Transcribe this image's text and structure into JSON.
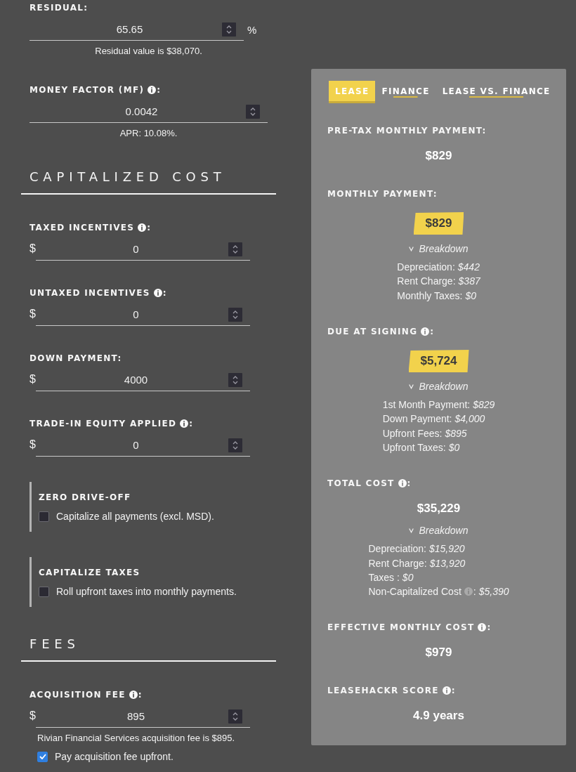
{
  "form": {
    "sections": [
      {
        "items": [
          {
            "kind": "number",
            "label": "RESIDUAL:",
            "value": "65.65",
            "unit": "%",
            "note": "Residual value is $38,070."
          },
          {
            "kind": "number",
            "label": "MONEY FACTOR (MF)",
            "info": true,
            "label_tail": ":",
            "value": "0.0042",
            "note": "APR: 10.08%."
          }
        ]
      },
      {
        "heading": "CAPITALIZED COST",
        "items": [
          {
            "kind": "number",
            "label": "TAXED INCENTIVES",
            "info": true,
            "label_tail": ":",
            "prefix": "$",
            "value": "0"
          },
          {
            "kind": "number",
            "label": "UNTAXED INCENTIVES",
            "info": true,
            "label_tail": ":",
            "prefix": "$",
            "value": "0"
          },
          {
            "kind": "number",
            "label": "DOWN PAYMENT:",
            "prefix": "$",
            "value": "4000"
          },
          {
            "kind": "number",
            "label": "TRADE-IN EQUITY APPLIED",
            "info": true,
            "label_tail": ":",
            "prefix": "$",
            "value": "0"
          },
          {
            "kind": "option",
            "title": "ZERO DRIVE-OFF",
            "checkbox": {
              "label": "Capitalize all payments (excl. MSD).",
              "checked": false
            }
          },
          {
            "kind": "option",
            "title": "CAPITALIZE TAXES",
            "checkbox": {
              "label": "Roll upfront taxes into monthly payments.",
              "checked": false
            }
          }
        ]
      },
      {
        "heading": "FEES",
        "items": [
          {
            "kind": "number",
            "label": "ACQUISITION FEE",
            "info": true,
            "label_tail": ":",
            "prefix": "$",
            "value": "895",
            "note": "Rivian Financial Services acquisition fee is $895.",
            "checkbox": {
              "label": "Pay acquisition fee upfront.",
              "checked": true
            }
          }
        ]
      }
    ]
  },
  "results": {
    "tabs": [
      {
        "label": "LEASE",
        "selected": true
      },
      {
        "label": "FINANCE",
        "selected": false
      },
      {
        "label": "LEASE VS. FINANCE",
        "selected": false
      }
    ],
    "metrics": [
      {
        "label": "PRE-TAX MONTHLY PAYMENT:",
        "value": "$829",
        "highlighted": false
      },
      {
        "label": "MONTHLY PAYMENT:",
        "value": "$829",
        "highlighted": true,
        "breakdown": {
          "toggle": "Breakdown",
          "expanded": true,
          "lines": [
            {
              "label": "Depreciation:",
              "value": "$442"
            },
            {
              "label": "Rent Charge:",
              "value": "$387"
            },
            {
              "label": "Monthly Taxes:",
              "value": "$0"
            }
          ]
        }
      },
      {
        "label": "DUE AT SIGNING",
        "info": true,
        "label_tail": ":",
        "value": "$5,724",
        "highlighted": true,
        "breakdown": {
          "toggle": "Breakdown",
          "expanded": true,
          "lines": [
            {
              "label": "1st Month Payment:",
              "value": "$829"
            },
            {
              "label": "Down Payment:",
              "value": "$4,000"
            },
            {
              "label": "Upfront Fees:",
              "value": "$895"
            },
            {
              "label": "Upfront Taxes:",
              "value": "$0"
            }
          ]
        }
      },
      {
        "label": "TOTAL COST",
        "info": true,
        "label_tail": ":",
        "value": "$35,229",
        "highlighted": false,
        "breakdown": {
          "toggle": "Breakdown",
          "expanded": true,
          "lines": [
            {
              "label": "Depreciation:",
              "value": "$15,920"
            },
            {
              "label": "Rent Charge:",
              "value": "$13,920"
            },
            {
              "label": "Taxes :",
              "value": "$0"
            },
            {
              "label": "Non-Capitalized Cost",
              "info": true,
              "label_tail": ":",
              "value": "$5,390"
            }
          ]
        }
      },
      {
        "label": "EFFECTIVE MONTHLY COST",
        "info": true,
        "label_tail": ":",
        "value": "$979",
        "highlighted": false
      },
      {
        "label": "LEASEHACKR SCORE",
        "info": true,
        "label_tail": ":",
        "value": "4.9 years",
        "highlighted": false
      }
    ]
  }
}
